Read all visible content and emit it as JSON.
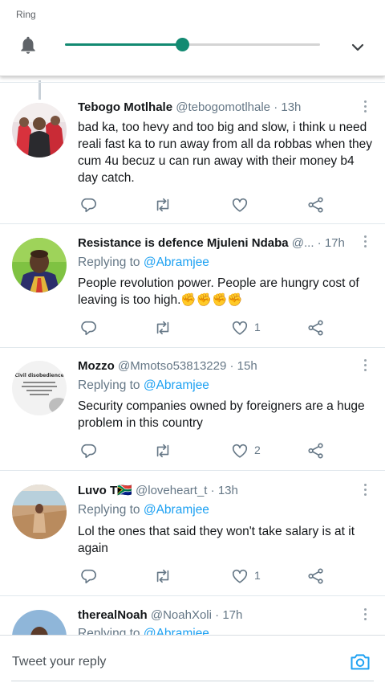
{
  "volume": {
    "title": "Ring",
    "level": 0.46,
    "accent": "#138a72"
  },
  "tweets": [
    {
      "name": "Tebogo Motlhale",
      "handle": "@tebogomotlhale",
      "sep": "·",
      "time": "13h",
      "reply_label": "",
      "reply_mention": "",
      "text": "bad ka, too hevy and too big and slow, i think u need reali fast ka to run away from all da robbas when they cum 4u becuz u can run away with their money b4 day catch.",
      "likes": ""
    },
    {
      "name": "Resistance is defence Mjuleni Ndaba",
      "handle": "@...",
      "sep": "·",
      "time": "17h",
      "reply_label": "Replying to",
      "reply_mention": "@Abramjee",
      "text": "People revolution power. People are hungry cost of leaving is too high.✊✊✊✊",
      "likes": "1"
    },
    {
      "name": "Mozzo",
      "handle": "@Mmotso53813229",
      "sep": "·",
      "time": "15h",
      "reply_label": "Replying to",
      "reply_mention": "@Abramjee",
      "text": "Security companies owned by foreigners are a huge problem in this country",
      "likes": "2",
      "avatar_text": "Civil disobedience becomes a sacred duty when the state has become lawless or corrupt."
    },
    {
      "name": "Luvo T🇿🇦",
      "handle": "@loveheart_t",
      "sep": "·",
      "time": "13h",
      "reply_label": "Replying to",
      "reply_mention": "@Abramjee",
      "text": "Lol the ones that said they won't take salary is at it again",
      "likes": "1"
    },
    {
      "name": "therealNoah",
      "handle": "@NoahXoli",
      "sep": "·",
      "time": "17h",
      "reply_label": "Replying to",
      "reply_mention": "@Abramjee",
      "text": "",
      "likes": ""
    }
  ],
  "reply_bar": {
    "placeholder": "Tweet your reply"
  },
  "icons": {
    "volume": "bell-icon",
    "expand": "chevron-down-icon",
    "reply": "reply-icon",
    "retweet": "retweet-icon",
    "like": "heart-icon",
    "share": "share-icon",
    "more": "more-vertical-icon",
    "camera": "camera-icon"
  },
  "colors": {
    "link": "#1da1f2",
    "secondary_text": "#657786",
    "primary_text": "#14171a"
  }
}
